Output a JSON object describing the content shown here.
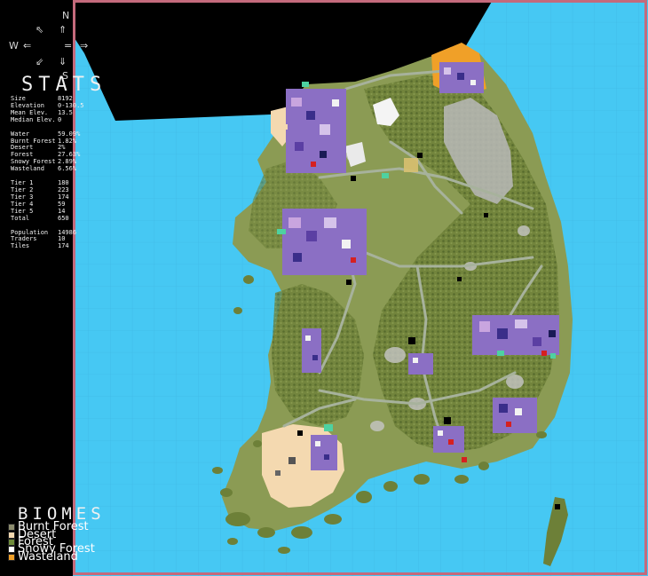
{
  "compass": {
    "north": "N",
    "west": "W",
    "south": "S",
    "arrow_n": "⇑",
    "arrow_w": "⇐",
    "arrow_e": "⇒",
    "arrow_sw": "⇙",
    "arrow_s": "⇓",
    "arrow_nw": "⇖",
    "equals": "="
  },
  "stats": {
    "title": "STATS",
    "rows": [
      {
        "key": "Size",
        "value": "8192"
      },
      {
        "key": "Elevation",
        "value": "0-130.5"
      },
      {
        "key": "Mean Elev.",
        "value": "13.5"
      },
      {
        "key": "Median Elev.",
        "value": "0"
      },
      {
        "key": "",
        "value": ""
      },
      {
        "key": "Water",
        "value": "59.09%"
      },
      {
        "key": "Burnt Forest",
        "value": "1.82%"
      },
      {
        "key": "Desert",
        "value": "2%"
      },
      {
        "key": "Forest",
        "value": "27.63%"
      },
      {
        "key": "Snowy Forest",
        "value": "2.89%"
      },
      {
        "key": "Wasteland",
        "value": "6.56%"
      },
      {
        "key": "",
        "value": ""
      },
      {
        "key": "Tier 1",
        "value": "180"
      },
      {
        "key": "Tier 2",
        "value": "223"
      },
      {
        "key": "Tier 3",
        "value": "174"
      },
      {
        "key": "Tier 4",
        "value": "59"
      },
      {
        "key": "Tier 5",
        "value": "14"
      },
      {
        "key": "Total",
        "value": "650"
      },
      {
        "key": "",
        "value": ""
      },
      {
        "key": "Population",
        "value": "14986"
      },
      {
        "key": "Traders",
        "value": "10"
      },
      {
        "key": "Tiles",
        "value": "174"
      }
    ]
  },
  "biomes": {
    "title": "BIOMES",
    "items": [
      {
        "label": "Burnt Forest",
        "color": "#8c8c6e"
      },
      {
        "label": "Desert",
        "color": "#f4d9b0"
      },
      {
        "label": "Forest",
        "color": "#6f8c3a"
      },
      {
        "label": "Snowy Forest",
        "color": "#ffffff"
      },
      {
        "label": "Wasteland",
        "color": "#f0a028"
      }
    ]
  },
  "colors": {
    "water": "#45c7f2",
    "land": "#8a9a52",
    "forest": "#5d7430",
    "desert": "#f4d9b0",
    "wasteland": "#f0a028",
    "snow": "#f4f4f4",
    "burnt": "#a9a9a9",
    "road": "#9aa79a",
    "town": "#8a6bbf",
    "border": "#c46a7c"
  }
}
